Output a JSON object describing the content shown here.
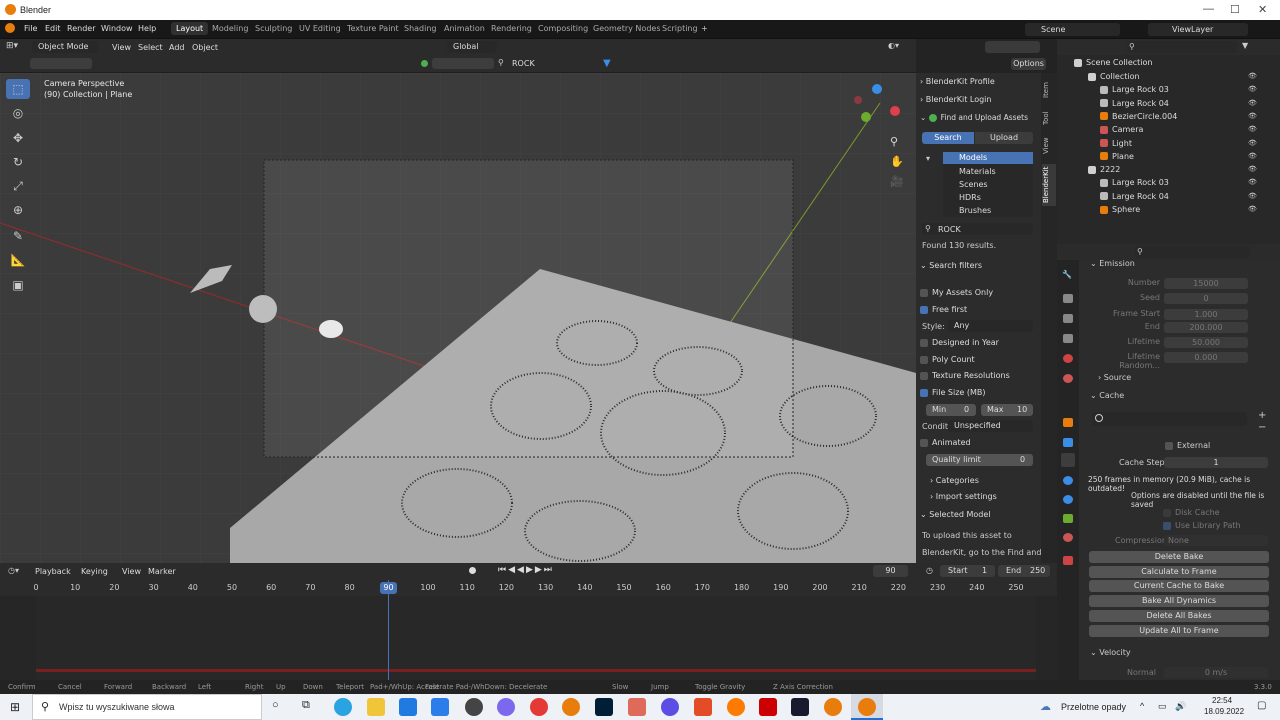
{
  "title": "Blender",
  "menus": [
    "File",
    "Edit",
    "Render",
    "Window",
    "Help"
  ],
  "workspaces": [
    "Layout",
    "Modeling",
    "Sculpting",
    "UV Editing",
    "Texture Paint",
    "Shading",
    "Animation",
    "Rendering",
    "Compositing",
    "Geometry Nodes",
    "Scripting"
  ],
  "active_workspace": "Layout",
  "scene": "Scene",
  "viewlayer": "ViewLayer",
  "vp": {
    "mode": "Object Mode",
    "view": "View",
    "select": "Select",
    "add": "Add",
    "object": "Object",
    "orient": "Global",
    "search": "ROCK",
    "options": "Options",
    "info1": "Camera Perspective",
    "info2": "(90) Collection | Plane"
  },
  "vtabs": [
    "Item",
    "Tool",
    "View",
    "BlenderKit"
  ],
  "bk": {
    "profile": "BlenderKit Profile",
    "login": "BlenderKit Login",
    "find": "Find and Upload Assets",
    "search_btn": "Search",
    "upload_btn": "Upload",
    "types": [
      "Models",
      "Materials",
      "Scenes",
      "HDRs",
      "Brushes"
    ],
    "query": "ROCK",
    "found": "Found 130 results.",
    "filters": "Search filters",
    "my_assets": "My Assets Only",
    "free_first": "Free first",
    "style_l": "Style:",
    "style_v": "Any",
    "designed": "Designed in Year",
    "poly": "Poly Count",
    "texres": "Texture Resolutions",
    "filesize": "File Size (MB)",
    "min_l": "Min",
    "min_v": "0",
    "max_l": "Max",
    "max_v": "10",
    "cond_l": "Conditi...",
    "cond_v": "Unspecified",
    "animated": "Animated",
    "quality_l": "Quality limit",
    "quality_v": "0",
    "categories": "Categories",
    "import": "Import settings",
    "selected": "Selected Model",
    "upload_msg1": "To upload this asset to",
    "upload_msg2": "BlenderKit, go to the Find and"
  },
  "outliner": {
    "root": "Scene Collection",
    "rows": [
      {
        "name": "Collection",
        "indent": 0
      },
      {
        "name": "Large Rock 03",
        "indent": 2
      },
      {
        "name": "Large Rock 04",
        "indent": 2
      },
      {
        "name": "BezierCircle.004",
        "indent": 1
      },
      {
        "name": "Camera",
        "indent": 1
      },
      {
        "name": "Light",
        "indent": 1
      },
      {
        "name": "Plane",
        "indent": 1
      },
      {
        "name": "2222",
        "indent": 0
      },
      {
        "name": "Large Rock 03",
        "indent": 1
      },
      {
        "name": "Large Rock 04",
        "indent": 1
      },
      {
        "name": "Sphere",
        "indent": 1
      }
    ]
  },
  "props": {
    "emission": "Emission",
    "number_l": "Number",
    "number_v": "15000",
    "seed_l": "Seed",
    "seed_v": "0",
    "fstart_l": "Frame Start",
    "fstart_v": "1.000",
    "end_l": "End",
    "end_v": "200.000",
    "life_l": "Lifetime",
    "life_v": "50.000",
    "liferand_l": "Lifetime Random...",
    "liferand_v": "0.000",
    "source": "Source",
    "cache": "Cache",
    "external": "External",
    "cachestep_l": "Cache Step",
    "cachestep_v": "1",
    "mem": "250 frames in memory (20.9 MiB), cache is outdated!",
    "disabled": "Options are disabled until the file is saved",
    "disk": "Disk Cache",
    "uselib": "Use Library Path",
    "comp_l": "Compression",
    "comp_v": "None",
    "buttons": [
      "Delete Bake",
      "Calculate to Frame",
      "Current Cache to Bake",
      "Bake All Dynamics",
      "Delete All Bakes",
      "Update All to Frame"
    ],
    "velocity": "Velocity",
    "normal_l": "Normal",
    "normal_v": "0 m/s"
  },
  "timeline": {
    "playback": "Playback",
    "keying": "Keying",
    "view": "View",
    "marker": "Marker",
    "current": "90",
    "start_l": "Start",
    "start_v": "1",
    "end_l": "End",
    "end_v": "250",
    "ticks": [
      "0",
      "10",
      "20",
      "30",
      "40",
      "50",
      "60",
      "70",
      "80",
      "90",
      "100",
      "110",
      "120",
      "130",
      "140",
      "150",
      "160",
      "170",
      "180",
      "190",
      "200",
      "210",
      "220",
      "230",
      "240",
      "250"
    ]
  },
  "status": [
    "Confirm",
    "Cancel",
    "Forward",
    "Backward",
    "Left",
    "Right",
    "Up",
    "Down",
    "Teleport",
    "Pad+/WhUp: Accelerate Pad-/WhDown: Decelerate",
    "Fast",
    "Slow",
    "Jump",
    "Toggle Gravity",
    "Z Axis Correction"
  ],
  "version": "3.3.0",
  "taskbar": {
    "search": "Wpisz tu wyszukiwane słowa",
    "weather": "Przelotne opady",
    "time": "22:54",
    "date": "18.09.2022"
  },
  "colors": {
    "accent": "#4772b3",
    "orange": "#e87d0d"
  }
}
